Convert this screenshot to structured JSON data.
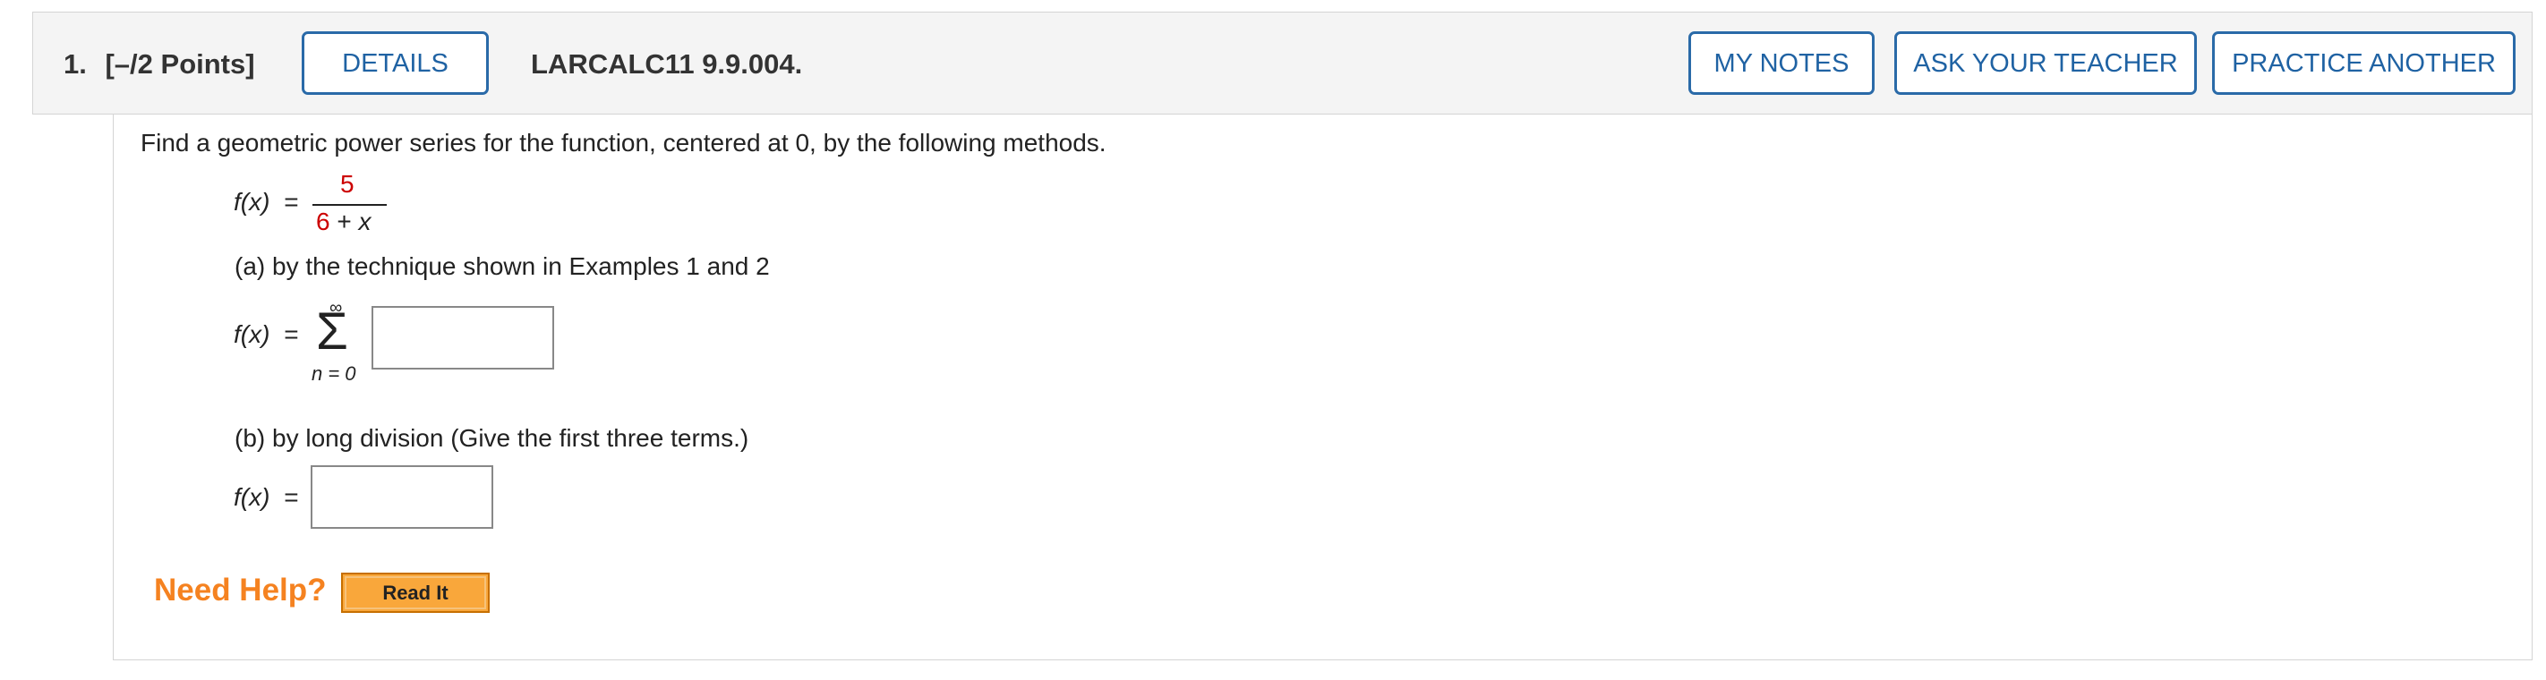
{
  "header": {
    "question_number": "1.",
    "points": "[–/2 Points]",
    "details_label": "DETAILS",
    "question_id": "LARCALC11 9.9.004.",
    "my_notes_label": "MY NOTES",
    "ask_teacher_label": "ASK YOUR TEACHER",
    "practice_label": "PRACTICE ANOTHER"
  },
  "problem": {
    "prompt": "Find a geometric power series for the function, centered at 0, by the following methods.",
    "fx_label": "f(x)",
    "equals": "=",
    "numerator": "5",
    "denominator_num": "6",
    "denominator_rest": " + ",
    "denominator_var": "x",
    "part_a": "(a) by the technique shown in Examples 1 and 2",
    "sum_upper": "∞",
    "sum_symbol": "Σ",
    "sum_lower": "n = 0",
    "part_b": "(b) by long division (Give the first three terms.)"
  },
  "inputs": {
    "series_answer": "",
    "division_answer": ""
  },
  "help": {
    "label": "Need Help?",
    "read_it": "Read It"
  },
  "colors": {
    "button_text": "#1f62a3",
    "highlight_red": "#cc0000",
    "help_orange": "#f58220",
    "read_it_bg": "#f9a73b"
  }
}
